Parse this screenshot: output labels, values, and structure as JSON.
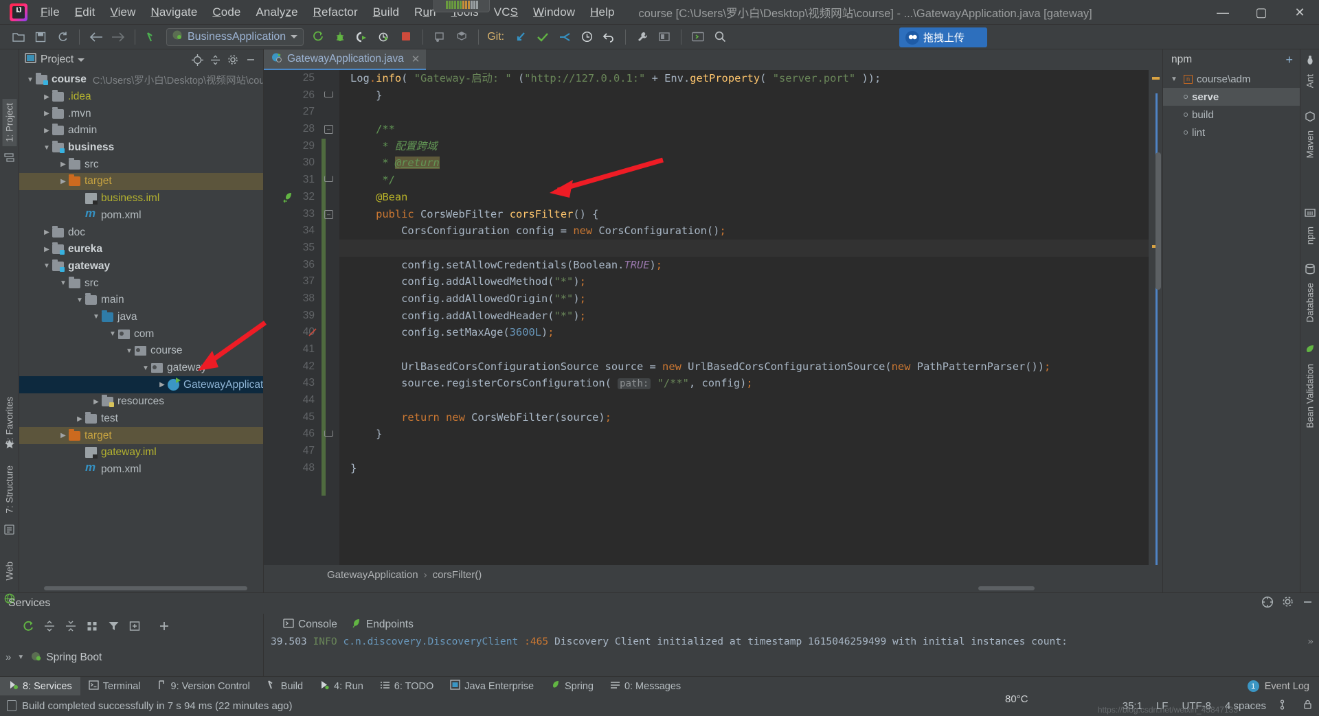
{
  "window": {
    "title": "course [C:\\Users\\罗小白\\Desktop\\视频网站\\course] - ...\\GatewayApplication.java [gateway]",
    "minimize": "—",
    "maximize": "▢",
    "close": "✕"
  },
  "menu": [
    {
      "label": "File"
    },
    {
      "label": "Edit"
    },
    {
      "label": "View"
    },
    {
      "label": "Navigate"
    },
    {
      "label": "Code"
    },
    {
      "label": "Analyze"
    },
    {
      "label": "Refactor"
    },
    {
      "label": "Build"
    },
    {
      "label": "Run"
    },
    {
      "label": "Tools"
    },
    {
      "label": "VCS"
    },
    {
      "label": "Window"
    },
    {
      "label": "Help"
    }
  ],
  "toolbar": {
    "open_icon": "open-folder-icon",
    "save_icon": "save-icon",
    "sync_icon": "sync-icon",
    "back_icon": "back-arrow-icon",
    "forward_icon": "forward-arrow-icon",
    "build_icon": "build-hammer-icon",
    "run_config_name": "BusinessApplication",
    "run_icon": "run-icon",
    "debug_icon": "debug-icon",
    "run_with_coverage_icon": "run-coverage-icon",
    "profile_icon": "profiler-icon",
    "stop_icon": "stop-icon",
    "git_label": "Git:",
    "update_icon": "vcs-update-icon",
    "commit_icon": "vcs-commit-icon",
    "push_icon": "vcs-push-icon",
    "history_icon": "vcs-history-icon",
    "rollback_icon": "vcs-rollback-icon",
    "settings_icon": "settings-wrench-icon",
    "project-structure_icon": "project-structure-icon",
    "search_icon": "search-icon",
    "upload_label": "拖拽上传"
  },
  "left_rail": [
    {
      "label": "1: Project",
      "selected": true
    },
    {
      "label": "2: Favorites",
      "selected": false
    },
    {
      "label": "7: Structure",
      "selected": false
    },
    {
      "label": "Web",
      "selected": false
    }
  ],
  "right_rail": [
    {
      "label": "Ant"
    },
    {
      "label": "Maven"
    },
    {
      "label": "npm"
    },
    {
      "label": "Database"
    },
    {
      "label": "Bean Validation"
    }
  ],
  "project": {
    "title": "Project",
    "locate_icon": "locate-file-icon",
    "collapse_icon": "collapse-all-icon",
    "gear_icon": "gear-icon",
    "minimize_icon": "minimize-icon",
    "tree": [
      {
        "depth": 0,
        "arrow": "d",
        "icon": "module-folder",
        "label": "course",
        "style": "bold",
        "path": "C:\\Users\\罗小白\\Desktop\\视频网站\\cou",
        "row": "normal"
      },
      {
        "depth": 1,
        "arrow": "r",
        "icon": "folder",
        "label": ".idea",
        "style": "yellow",
        "row": "normal"
      },
      {
        "depth": 1,
        "arrow": "r",
        "icon": "folder",
        "label": ".mvn",
        "style": "plain",
        "row": "normal"
      },
      {
        "depth": 1,
        "arrow": "r",
        "icon": "folder",
        "label": "admin",
        "style": "plain",
        "row": "normal"
      },
      {
        "depth": 1,
        "arrow": "d",
        "icon": "module-folder",
        "label": "business",
        "style": "bold",
        "row": "normal"
      },
      {
        "depth": 2,
        "arrow": "r",
        "icon": "folder",
        "label": "src",
        "style": "plain",
        "row": "normal"
      },
      {
        "depth": 2,
        "arrow": "r",
        "icon": "folder-orange",
        "label": "target",
        "style": "orange-sel",
        "row": "brown"
      },
      {
        "depth": 3,
        "arrow": "",
        "icon": "iml",
        "label": "business.iml",
        "style": "yellow",
        "row": "normal"
      },
      {
        "depth": 3,
        "arrow": "",
        "icon": "maven",
        "label": "pom.xml",
        "style": "plain",
        "row": "normal"
      },
      {
        "depth": 1,
        "arrow": "r",
        "icon": "folder",
        "label": "doc",
        "style": "plain",
        "row": "normal"
      },
      {
        "depth": 1,
        "arrow": "r",
        "icon": "module-folder",
        "label": "eureka",
        "style": "bold",
        "row": "normal"
      },
      {
        "depth": 1,
        "arrow": "d",
        "icon": "module-folder",
        "label": "gateway",
        "style": "bold",
        "row": "normal"
      },
      {
        "depth": 2,
        "arrow": "d",
        "icon": "folder",
        "label": "src",
        "style": "plain",
        "row": "normal"
      },
      {
        "depth": 3,
        "arrow": "d",
        "icon": "folder",
        "label": "main",
        "style": "plain",
        "row": "normal"
      },
      {
        "depth": 4,
        "arrow": "d",
        "icon": "folder-blue",
        "label": "java",
        "style": "plain",
        "row": "normal"
      },
      {
        "depth": 5,
        "arrow": "d",
        "icon": "package",
        "label": "com",
        "style": "plain",
        "row": "normal"
      },
      {
        "depth": 6,
        "arrow": "d",
        "icon": "package",
        "label": "course",
        "style": "plain",
        "row": "normal"
      },
      {
        "depth": 7,
        "arrow": "d",
        "icon": "package",
        "label": "gateway",
        "style": "plain",
        "row": "normal"
      },
      {
        "depth": 8,
        "arrow": "r",
        "icon": "class",
        "label": "GatewayApplication",
        "style": "blue",
        "row": "blue"
      },
      {
        "depth": 4,
        "arrow": "r",
        "icon": "folder-res",
        "label": "resources",
        "style": "plain",
        "row": "normal"
      },
      {
        "depth": 3,
        "arrow": "r",
        "icon": "folder",
        "label": "test",
        "style": "plain",
        "row": "normal"
      },
      {
        "depth": 2,
        "arrow": "r",
        "icon": "folder-orange",
        "label": "target",
        "style": "orange-sel",
        "row": "brown"
      },
      {
        "depth": 3,
        "arrow": "",
        "icon": "iml",
        "label": "gateway.iml",
        "style": "yellow",
        "row": "normal"
      },
      {
        "depth": 3,
        "arrow": "",
        "icon": "maven",
        "label": "pom.xml",
        "style": "plain",
        "row": "normal"
      }
    ]
  },
  "editor": {
    "tab": {
      "label": "GatewayApplication.java",
      "icon": "java-class-icon",
      "close": "✕"
    },
    "first_line_number": 25,
    "lines": [
      {
        "n": 25,
        "text": "Log.info( \"Gateway-启动: \" (\"http://127.0.0.1:\" + Env.getProperty( \"server.port\" ));",
        "kind": "partial"
      },
      {
        "n": 26,
        "text": "    }",
        "kind": "plain",
        "fold": "end"
      },
      {
        "n": 27,
        "text": "",
        "kind": "plain"
      },
      {
        "n": 28,
        "text": "    /**",
        "kind": "comment",
        "fold": "start"
      },
      {
        "n": 29,
        "text": "     * 配置跨域",
        "kind": "comment-italic"
      },
      {
        "n": 30,
        "text": "     * @return",
        "kind": "comment-tag"
      },
      {
        "n": 31,
        "text": "     */",
        "kind": "comment",
        "fold": "end"
      },
      {
        "n": 32,
        "text": "    @Bean",
        "kind": "annotation",
        "gutter_icon": "bean-icon"
      },
      {
        "n": 33,
        "text": "    public CorsWebFilter corsFilter() {",
        "kind": "signature",
        "fold": "start"
      },
      {
        "n": 34,
        "text": "        CorsConfiguration config = new CorsConfiguration();",
        "kind": "code"
      },
      {
        "n": 35,
        "text": "",
        "kind": "plain",
        "highlight": true
      },
      {
        "n": 36,
        "text": "        config.setAllowCredentials(Boolean.TRUE);",
        "kind": "code"
      },
      {
        "n": 37,
        "text": "        config.addAllowedMethod(\"*\");",
        "kind": "code"
      },
      {
        "n": 38,
        "text": "        config.addAllowedOrigin(\"*\");",
        "kind": "code"
      },
      {
        "n": 39,
        "text": "        config.addAllowedHeader(\"*\");",
        "kind": "code"
      },
      {
        "n": 40,
        "text": "        config.setMaxAge(3600L);",
        "kind": "code",
        "strikeout": true
      },
      {
        "n": 41,
        "text": "",
        "kind": "plain"
      },
      {
        "n": 42,
        "text": "        UrlBasedCorsConfigurationSource source = new UrlBasedCorsConfigurationSource(new PathPatternParser());",
        "kind": "code"
      },
      {
        "n": 43,
        "text": "        source.registerCorsConfiguration( path: \"/**\", config);",
        "kind": "code-hint",
        "hint": "path:"
      },
      {
        "n": 44,
        "text": "",
        "kind": "plain"
      },
      {
        "n": 45,
        "text": "        return new CorsWebFilter(source);",
        "kind": "code"
      },
      {
        "n": 46,
        "text": "    }",
        "kind": "plain",
        "fold": "end"
      },
      {
        "n": 47,
        "text": "",
        "kind": "plain"
      },
      {
        "n": 48,
        "text": "}",
        "kind": "plain"
      }
    ],
    "breadcrumb": [
      "GatewayApplication",
      "corsFilter()"
    ],
    "breadcrumb_sep": "›"
  },
  "npm": {
    "title": "npm",
    "add_icon": "add-icon",
    "root": "course\\adm",
    "items": [
      {
        "label": "serve",
        "selected": true
      },
      {
        "label": "build",
        "selected": false
      },
      {
        "label": "lint",
        "selected": false
      }
    ]
  },
  "services": {
    "title": "Services",
    "header_actions": [
      "help-icon",
      "gear-icon",
      "minimize-icon"
    ],
    "toolbar_icons": [
      "rerun-icon",
      "expand-all-icon",
      "collapse-all-icon",
      "group-icon",
      "filter-icon",
      "add-tab-icon",
      "add-icon"
    ],
    "tree_root": "Spring Boot",
    "tree_expand": "»",
    "tabs": [
      {
        "label": "Console",
        "icon": "console-icon"
      },
      {
        "label": "Endpoints",
        "icon": "endpoints-icon"
      }
    ],
    "console": {
      "time": "39.503",
      "level": "INFO",
      "logger": "c.n.discovery.DiscoveryClient",
      "line": ":465",
      "message": "Discovery Client initialized at timestamp 1615046259499 with initial instances count:",
      "more": "»"
    }
  },
  "tool_windows": [
    {
      "label": "8: Services",
      "icon": "services-icon",
      "selected": true,
      "mnemonic": "8"
    },
    {
      "label": "Terminal",
      "icon": "terminal-icon",
      "selected": false
    },
    {
      "label": "9: Version Control",
      "icon": "vcs-icon",
      "selected": false,
      "mnemonic": "9"
    },
    {
      "label": "Build",
      "icon": "build-icon",
      "selected": false
    },
    {
      "label": "4: Run",
      "icon": "run-icon",
      "selected": false,
      "mnemonic": "4"
    },
    {
      "label": "6: TODO",
      "icon": "todo-icon",
      "selected": false,
      "mnemonic": "6"
    },
    {
      "label": "Java Enterprise",
      "icon": "java-enterprise-icon",
      "selected": false
    },
    {
      "label": "Spring",
      "icon": "spring-icon",
      "selected": false
    },
    {
      "label": "0: Messages",
      "icon": "messages-icon",
      "selected": false,
      "mnemonic": "0"
    }
  ],
  "event_log": {
    "label": "Event Log",
    "count": "1"
  },
  "status": {
    "message": "Build completed successfully in 7 s 94 ms (22 minutes ago)",
    "caret": "35:1",
    "line_sep": "LF",
    "encoding": "UTF-8",
    "indent": "4 spaces",
    "branch_icon": "branch-icon",
    "lock_icon": "lock-icon",
    "watermark": "https://blog.csdn.net/weixin_45847133",
    "zoom": "80°C"
  },
  "colors": {
    "accent_blue": "#4a88c7",
    "editor_bg": "#2b2b2b",
    "panel_bg": "#3c3f41",
    "selection_blue": "#0d293e",
    "selection_brown": "#5c553c",
    "keyword_orange": "#cc7832",
    "string_green": "#6a8759",
    "annotation_yellow": "#bbb529",
    "number_blue": "#6897bb",
    "arrow_red": "#ee1c25"
  }
}
